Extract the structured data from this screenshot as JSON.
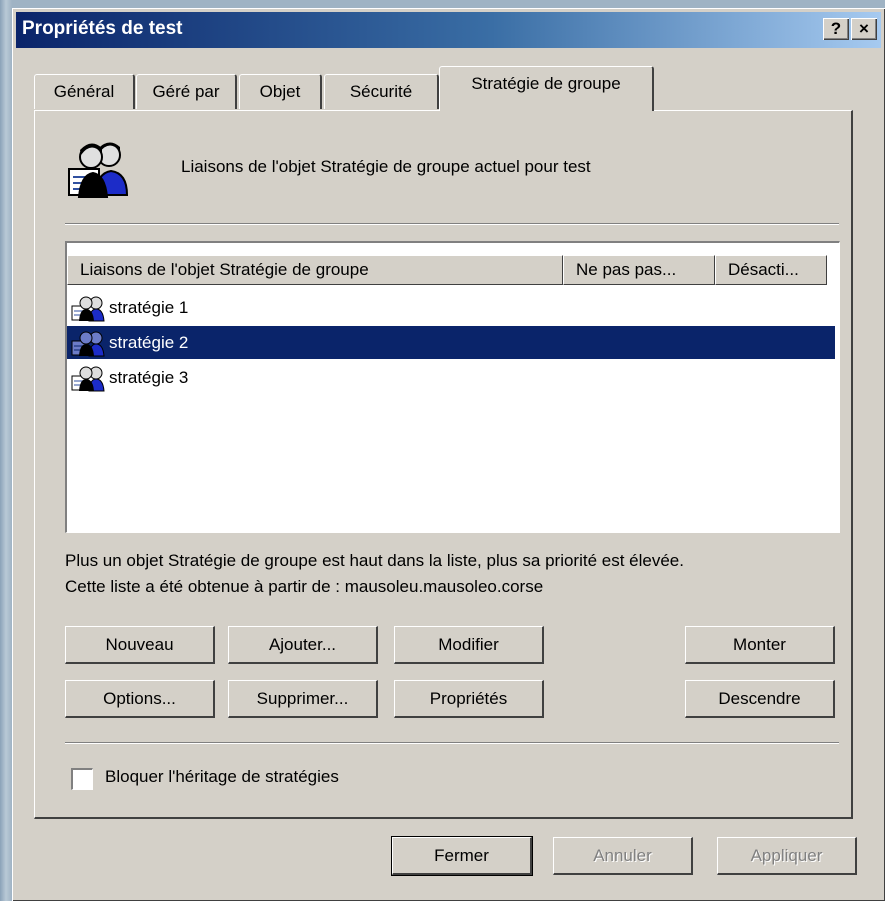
{
  "window": {
    "title": "Propriétés de test",
    "help_label": "?",
    "close_label": "×"
  },
  "tabs": [
    {
      "label": "Général"
    },
    {
      "label": "Géré par"
    },
    {
      "label": "Objet"
    },
    {
      "label": "Sécurité"
    },
    {
      "label": "Stratégie de groupe",
      "active": true
    }
  ],
  "header": {
    "text": "Liaisons de l'objet Stratégie de groupe actuel pour test",
    "icon": "users-policy-icon"
  },
  "list": {
    "columns": [
      "Liaisons de l'objet Stratégie de groupe",
      "Ne pas pas...",
      "Désacti..."
    ],
    "rows": [
      {
        "label": "stratégie 1",
        "selected": false
      },
      {
        "label": "stratégie 2",
        "selected": true
      },
      {
        "label": "stratégie 3",
        "selected": false
      }
    ]
  },
  "info": {
    "line1": "Plus un objet Stratégie de groupe est haut dans la liste, plus sa priorité est élevée.",
    "line2": "Cette liste a été obtenue à partir de : mausoleu.mausoleo.corse"
  },
  "buttons": {
    "nouveau": "Nouveau",
    "ajouter": "Ajouter...",
    "modifier": "Modifier",
    "monter": "Monter",
    "options": "Options...",
    "supprimer": "Supprimer...",
    "proprietes": "Propriétés",
    "descendre": "Descendre"
  },
  "checkbox": {
    "label": "Bloquer l'héritage de stratégies",
    "checked": false
  },
  "footer": {
    "fermer": "Fermer",
    "annuler": "Annuler",
    "appliquer": "Appliquer"
  }
}
